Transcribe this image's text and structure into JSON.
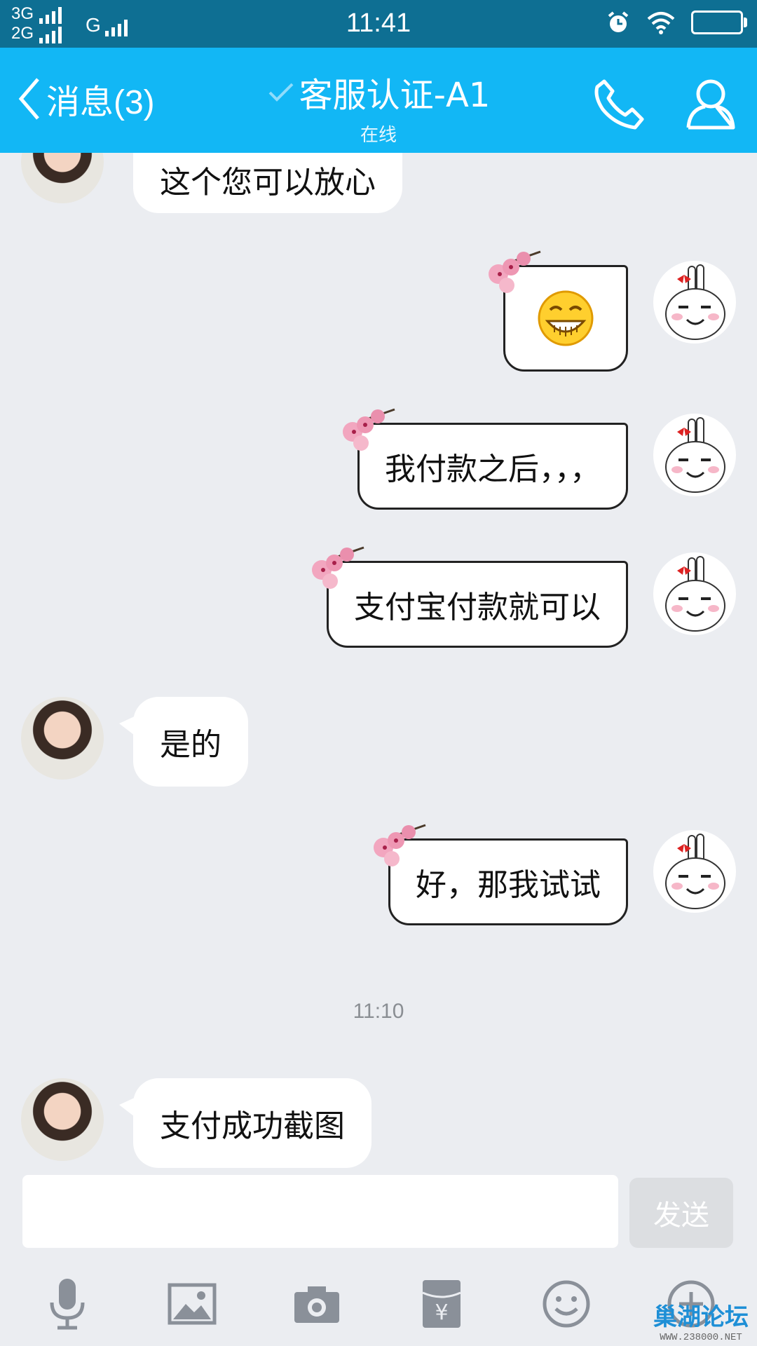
{
  "status_bar": {
    "network_1": "3G",
    "network_2": "2G",
    "network_3": "G",
    "time": "11:41"
  },
  "header": {
    "back_label": "消息(3)",
    "title": "客服认证-A1",
    "subtitle": "在线"
  },
  "messages": [
    {
      "side": "in",
      "text": "这个您可以放心"
    },
    {
      "side": "out",
      "emoji": "grin-emoji"
    },
    {
      "side": "out",
      "text": "我付款之后，，，"
    },
    {
      "side": "out",
      "text": "支付宝付款就可以"
    },
    {
      "side": "in",
      "text": "是的"
    },
    {
      "side": "out",
      "text": "好，那我试试"
    },
    {
      "side": "in",
      "text": "支付成功截图"
    }
  ],
  "time_separator": "11:10",
  "input": {
    "value": "",
    "send_label": "发送"
  },
  "toolbar_icons": [
    "microphone-icon",
    "image-icon",
    "camera-icon",
    "red-packet-icon",
    "emoji-icon",
    "plus-icon"
  ],
  "watermark": {
    "title": "巢湖论坛",
    "url": "WWW.238000.NET"
  },
  "colors": {
    "status_bar": "#0e6f93",
    "title_bar": "#12b7f5",
    "chat_bg": "#ebedf1"
  }
}
